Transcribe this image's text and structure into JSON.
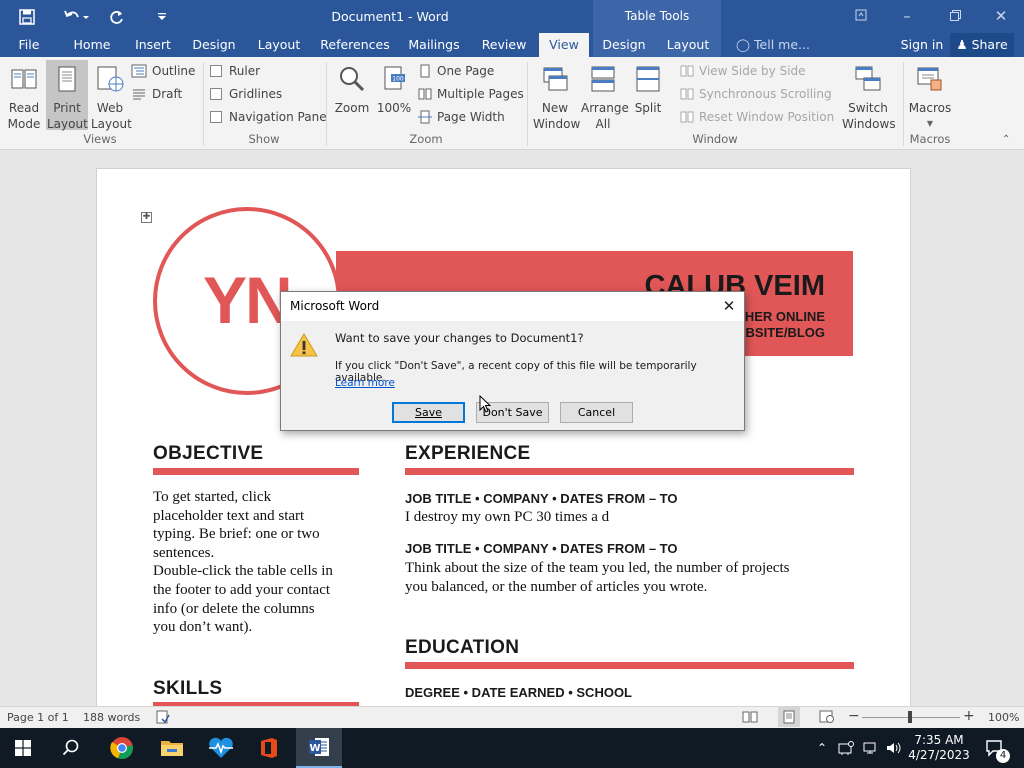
{
  "titlebar": {
    "doc_title": "Document1 - Word",
    "context_tab_group": "Table Tools",
    "tell_me": "Tell me...",
    "sign_in": "Sign in",
    "share": "Share"
  },
  "tabs": [
    "File",
    "Home",
    "Insert",
    "Design",
    "Layout",
    "References",
    "Mailings",
    "Review",
    "View",
    "Design",
    "Layout"
  ],
  "active_tab": "View",
  "ribbon": {
    "views": {
      "read_mode": "Read Mode",
      "print_layout": "Print Layout",
      "web_layout": "Web Layout",
      "outline": "Outline",
      "draft": "Draft",
      "group": "Views"
    },
    "show": {
      "ruler": "Ruler",
      "gridlines": "Gridlines",
      "navigation_pane": "Navigation Pane",
      "group": "Show"
    },
    "zoom": {
      "zoom": "Zoom",
      "hundred": "100%",
      "one_page": "One Page",
      "multiple_pages": "Multiple Pages",
      "page_width": "Page Width",
      "group": "Zoom"
    },
    "window": {
      "new_window": "New Window",
      "arrange_all": "Arrange All",
      "split": "Split",
      "view_side_by_side": "View Side by Side",
      "sync_scrolling": "Synchronous Scrolling",
      "reset_position": "Reset Window Position",
      "switch_windows": "Switch Windows",
      "group": "Window"
    },
    "macros": {
      "macros": "Macros",
      "group": "Macros"
    }
  },
  "document": {
    "initials": "YN",
    "name": "CALUB VEIM",
    "subtitle_line1": "THER ONLINE",
    "subtitle_line2": "BSITE/BLOG",
    "objective_heading": "OBJECTIVE",
    "objective_text": [
      "To get started, click",
      "placeholder text and start",
      "typing. Be brief: one or two",
      "sentences.",
      "Double-click the table cells in",
      "the footer to add your contact",
      "info (or delete the columns",
      "you don’t want)."
    ],
    "skills_heading": "SKILLS",
    "experience_heading": "EXPERIENCE",
    "job1_title": "JOB TITLE • COMPANY • DATES FROM – TO",
    "job1_text": "I destroy my own PC 30 times a d",
    "job2_title": "JOB TITLE • COMPANY • DATES FROM – TO",
    "job2_text": [
      "Think about the size of the team you led, the number of projects",
      "you balanced, or the number of articles you wrote."
    ],
    "education_heading": "EDUCATION",
    "degree_line": "DEGREE • DATE EARNED • SCHOOL"
  },
  "dialog": {
    "title": "Microsoft Word",
    "message": "Want to save your changes to Document1?",
    "info": "If you click \"Don't Save\", a recent copy of this file will be temporarily available.",
    "learn_more": "Learn more",
    "save": "Save",
    "dont_save": "Don't Save",
    "cancel": "Cancel"
  },
  "statusbar": {
    "page": "Page 1 of 1",
    "words": "188 words",
    "zoom": "100%"
  },
  "taskbar": {
    "time": "7:35 AM",
    "date": "4/27/2023",
    "notifications": "4"
  },
  "colors": {
    "word_blue": "#2b579a",
    "accent_red": "#e15757",
    "taskbar": "#101a24"
  }
}
